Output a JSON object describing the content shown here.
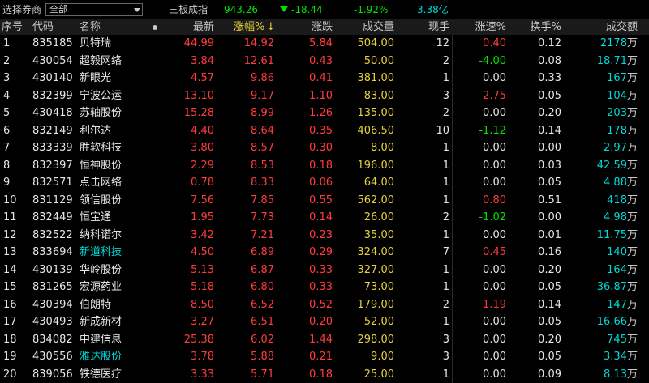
{
  "topbar": {
    "broker_label": "选择券商",
    "broker_select": "全部",
    "index_name": "三板成指",
    "index_value": "943.26",
    "index_change": "-18.44",
    "index_pct": "-1.92%",
    "index_amount": "3.38亿"
  },
  "columns": [
    "序号",
    "代码",
    "名称",
    "最新",
    "涨幅%",
    "涨跌",
    "成交量",
    "现手",
    "涨速%",
    "换手%",
    "成交额"
  ],
  "sort_arrow": "↓",
  "colors": {
    "red": "#ff3c3c",
    "green": "#00e600",
    "cyan": "#00d8d8",
    "yellow": "#e6d23c"
  },
  "rows": [
    {
      "no": "1",
      "code": "835185",
      "name": "贝特瑞",
      "name_color": "white",
      "last": "44.99",
      "pct": "14.92",
      "chg": "5.84",
      "vol": "504.00",
      "hand": "12",
      "speed": "0.40",
      "speed_color": "red",
      "turn": "0.12",
      "amount_num": "2178",
      "amount_unit": "万"
    },
    {
      "no": "2",
      "code": "430054",
      "name": "超毅网络",
      "name_color": "white",
      "last": "3.84",
      "pct": "12.61",
      "chg": "0.43",
      "vol": "50.00",
      "hand": "2",
      "speed": "-4.00",
      "speed_color": "green",
      "turn": "0.08",
      "amount_num": "18.71",
      "amount_unit": "万"
    },
    {
      "no": "3",
      "code": "430140",
      "name": "新眼光",
      "name_color": "white",
      "last": "4.57",
      "pct": "9.86",
      "chg": "0.41",
      "vol": "381.00",
      "hand": "1",
      "speed": "0.00",
      "speed_color": "white",
      "turn": "0.33",
      "amount_num": "167",
      "amount_unit": "万"
    },
    {
      "no": "4",
      "code": "832399",
      "name": "宁波公运",
      "name_color": "white",
      "last": "13.10",
      "pct": "9.17",
      "chg": "1.10",
      "vol": "83.00",
      "hand": "3",
      "speed": "2.75",
      "speed_color": "red",
      "turn": "0.05",
      "amount_num": "104",
      "amount_unit": "万"
    },
    {
      "no": "5",
      "code": "430418",
      "name": "苏轴股份",
      "name_color": "white",
      "last": "15.28",
      "pct": "8.99",
      "chg": "1.26",
      "vol": "135.00",
      "hand": "2",
      "speed": "0.00",
      "speed_color": "white",
      "turn": "0.20",
      "amount_num": "203",
      "amount_unit": "万"
    },
    {
      "no": "6",
      "code": "832149",
      "name": "利尔达",
      "name_color": "white",
      "last": "4.40",
      "pct": "8.64",
      "chg": "0.35",
      "vol": "406.50",
      "hand": "10",
      "speed": "-1.12",
      "speed_color": "green",
      "turn": "0.14",
      "amount_num": "178",
      "amount_unit": "万"
    },
    {
      "no": "7",
      "code": "833339",
      "name": "胜软科技",
      "name_color": "white",
      "last": "3.80",
      "pct": "8.57",
      "chg": "0.30",
      "vol": "8.00",
      "hand": "1",
      "speed": "0.00",
      "speed_color": "white",
      "turn": "0.00",
      "amount_num": "2.97",
      "amount_unit": "万"
    },
    {
      "no": "8",
      "code": "832397",
      "name": "恒神股份",
      "name_color": "white",
      "last": "2.29",
      "pct": "8.53",
      "chg": "0.18",
      "vol": "196.00",
      "hand": "1",
      "speed": "0.00",
      "speed_color": "white",
      "turn": "0.03",
      "amount_num": "42.59",
      "amount_unit": "万"
    },
    {
      "no": "9",
      "code": "832571",
      "name": "点击网络",
      "name_color": "white",
      "last": "0.78",
      "pct": "8.33",
      "chg": "0.06",
      "vol": "64.00",
      "hand": "1",
      "speed": "0.00",
      "speed_color": "white",
      "turn": "0.05",
      "amount_num": "4.88",
      "amount_unit": "万"
    },
    {
      "no": "10",
      "code": "831129",
      "name": "领信股份",
      "name_color": "white",
      "last": "7.56",
      "pct": "7.85",
      "chg": "0.55",
      "vol": "562.00",
      "hand": "1",
      "speed": "0.80",
      "speed_color": "red",
      "turn": "0.51",
      "amount_num": "418",
      "amount_unit": "万"
    },
    {
      "no": "11",
      "code": "832449",
      "name": "恒宝通",
      "name_color": "white",
      "last": "1.95",
      "pct": "7.73",
      "chg": "0.14",
      "vol": "26.00",
      "hand": "2",
      "speed": "-1.02",
      "speed_color": "green",
      "turn": "0.00",
      "amount_num": "4.98",
      "amount_unit": "万"
    },
    {
      "no": "12",
      "code": "832522",
      "name": "纳科诺尔",
      "name_color": "white",
      "last": "3.42",
      "pct": "7.21",
      "chg": "0.23",
      "vol": "35.00",
      "hand": "1",
      "speed": "0.00",
      "speed_color": "white",
      "turn": "0.01",
      "amount_num": "11.75",
      "amount_unit": "万"
    },
    {
      "no": "13",
      "code": "833694",
      "name": "新道科技",
      "name_color": "cyan",
      "last": "4.50",
      "pct": "6.89",
      "chg": "0.29",
      "vol": "324.00",
      "hand": "7",
      "speed": "0.45",
      "speed_color": "red",
      "turn": "0.16",
      "amount_num": "140",
      "amount_unit": "万"
    },
    {
      "no": "14",
      "code": "430139",
      "name": "华岭股份",
      "name_color": "white",
      "last": "5.13",
      "pct": "6.87",
      "chg": "0.33",
      "vol": "327.00",
      "hand": "1",
      "speed": "0.00",
      "speed_color": "white",
      "turn": "0.20",
      "amount_num": "164",
      "amount_unit": "万"
    },
    {
      "no": "15",
      "code": "831265",
      "name": "宏源药业",
      "name_color": "white",
      "last": "5.18",
      "pct": "6.80",
      "chg": "0.33",
      "vol": "73.00",
      "hand": "1",
      "speed": "0.00",
      "speed_color": "white",
      "turn": "0.05",
      "amount_num": "36.87",
      "amount_unit": "万"
    },
    {
      "no": "16",
      "code": "430394",
      "name": "伯朗特",
      "name_color": "white",
      "last": "8.50",
      "pct": "6.52",
      "chg": "0.52",
      "vol": "179.00",
      "hand": "2",
      "speed": "1.19",
      "speed_color": "red",
      "turn": "0.14",
      "amount_num": "147",
      "amount_unit": "万"
    },
    {
      "no": "17",
      "code": "430493",
      "name": "新成新材",
      "name_color": "white",
      "last": "3.27",
      "pct": "6.51",
      "chg": "0.20",
      "vol": "52.00",
      "hand": "1",
      "speed": "0.00",
      "speed_color": "white",
      "turn": "0.05",
      "amount_num": "16.66",
      "amount_unit": "万"
    },
    {
      "no": "18",
      "code": "834082",
      "name": "中建信息",
      "name_color": "white",
      "last": "25.38",
      "pct": "6.02",
      "chg": "1.44",
      "vol": "298.00",
      "hand": "3",
      "speed": "0.00",
      "speed_color": "white",
      "turn": "0.20",
      "amount_num": "745",
      "amount_unit": "万"
    },
    {
      "no": "19",
      "code": "430556",
      "name": "雅达股份",
      "name_color": "cyan",
      "last": "3.78",
      "pct": "5.88",
      "chg": "0.21",
      "vol": "9.00",
      "hand": "3",
      "speed": "0.00",
      "speed_color": "white",
      "turn": "0.05",
      "amount_num": "3.34",
      "amount_unit": "万"
    },
    {
      "no": "20",
      "code": "839056",
      "name": "铁德医疗",
      "name_color": "white",
      "last": "3.33",
      "pct": "5.71",
      "chg": "0.18",
      "vol": "25.00",
      "hand": "1",
      "speed": "0.00",
      "speed_color": "white",
      "turn": "0.09",
      "amount_num": "8.13",
      "amount_unit": "万"
    }
  ]
}
